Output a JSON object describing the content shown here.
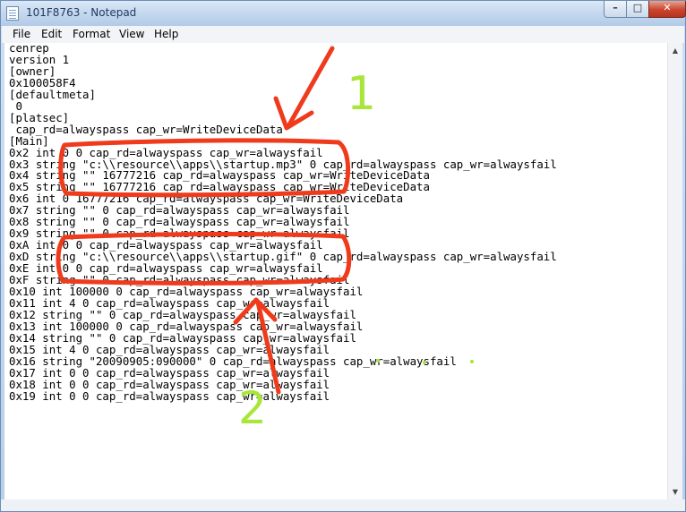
{
  "window": {
    "title": "101F8763 - Notepad",
    "icon": "notepad-icon",
    "controls": {
      "minimize": "minimize-icon",
      "maximize": "maximize-icon",
      "close": "close-icon"
    }
  },
  "menu": [
    "File",
    "Edit",
    "Format",
    "View",
    "Help"
  ],
  "editor": {
    "lines": [
      "cenrep",
      "version 1",
      "[owner]",
      "0x100058F4",
      "[defaultmeta]",
      " 0",
      "[platsec]",
      " cap_rd=alwayspass cap_wr=WriteDeviceData",
      "[Main]",
      "0x2 int 0 0 cap_rd=alwayspass cap_wr=alwaysfail",
      "0x3 string \"c:\\\\resource\\\\apps\\\\startup.mp3\" 0 cap_rd=alwayspass cap_wr=alwaysfail",
      "0x4 string \"\" 16777216 cap_rd=alwayspass cap_wr=WriteDeviceData",
      "0x5 string \"\" 16777216 cap_rd=alwayspass cap_wr=WriteDeviceData",
      "0x6 int 0 16777216 cap_rd=alwayspass cap_wr=WriteDeviceData",
      "0x7 string \"\" 0 cap_rd=alwayspass cap_wr=alwaysfail",
      "0x8 string \"\" 0 cap_rd=alwayspass cap_wr=alwaysfail",
      "0x9 string \"\" 0 cap_rd=alwayspass cap_wr=alwaysfail",
      "0xA int 0 0 cap_rd=alwayspass cap_wr=alwaysfail",
      "0xD string \"c:\\\\resource\\\\apps\\\\startup.gif\" 0 cap_rd=alwayspass cap_wr=alwaysfail",
      "0xE int 0 0 cap_rd=alwayspass cap_wr=alwaysfail",
      "0xF string \"\" 0 cap_rd=alwayspass cap_wr=alwaysfail",
      "0x10 int 100000 0 cap_rd=alwayspass cap_wr=alwaysfail",
      "0x11 int 4 0 cap_rd=alwayspass cap_wr=alwaysfail",
      "0x12 string \"\" 0 cap_rd=alwayspass cap_wr=alwaysfail",
      "0x13 int 100000 0 cap_rd=alwayspass cap_wr=alwaysfail",
      "0x14 string \"\" 0 cap_rd=alwayspass cap_wr=alwaysfail",
      "0x15 int 4 0 cap_rd=alwayspass cap_wr=alwaysfail",
      "0x16 string \"20090905:090000\" 0 cap_rd=alwayspass cap_wr=alwaysfail",
      "0x17 int 0 0 cap_rd=alwayspass cap_wr=alwaysfail",
      "0x18 int 0 0 cap_rd=alwayspass cap_wr=alwaysfail",
      "0x19 int 0 0 cap_rd=alwayspass cap_wr=alwaysfail"
    ]
  },
  "annotations": {
    "label_1": "1",
    "label_2": "2",
    "colors": {
      "marker": "#ef3b1c",
      "label": "#a8e63a"
    }
  }
}
